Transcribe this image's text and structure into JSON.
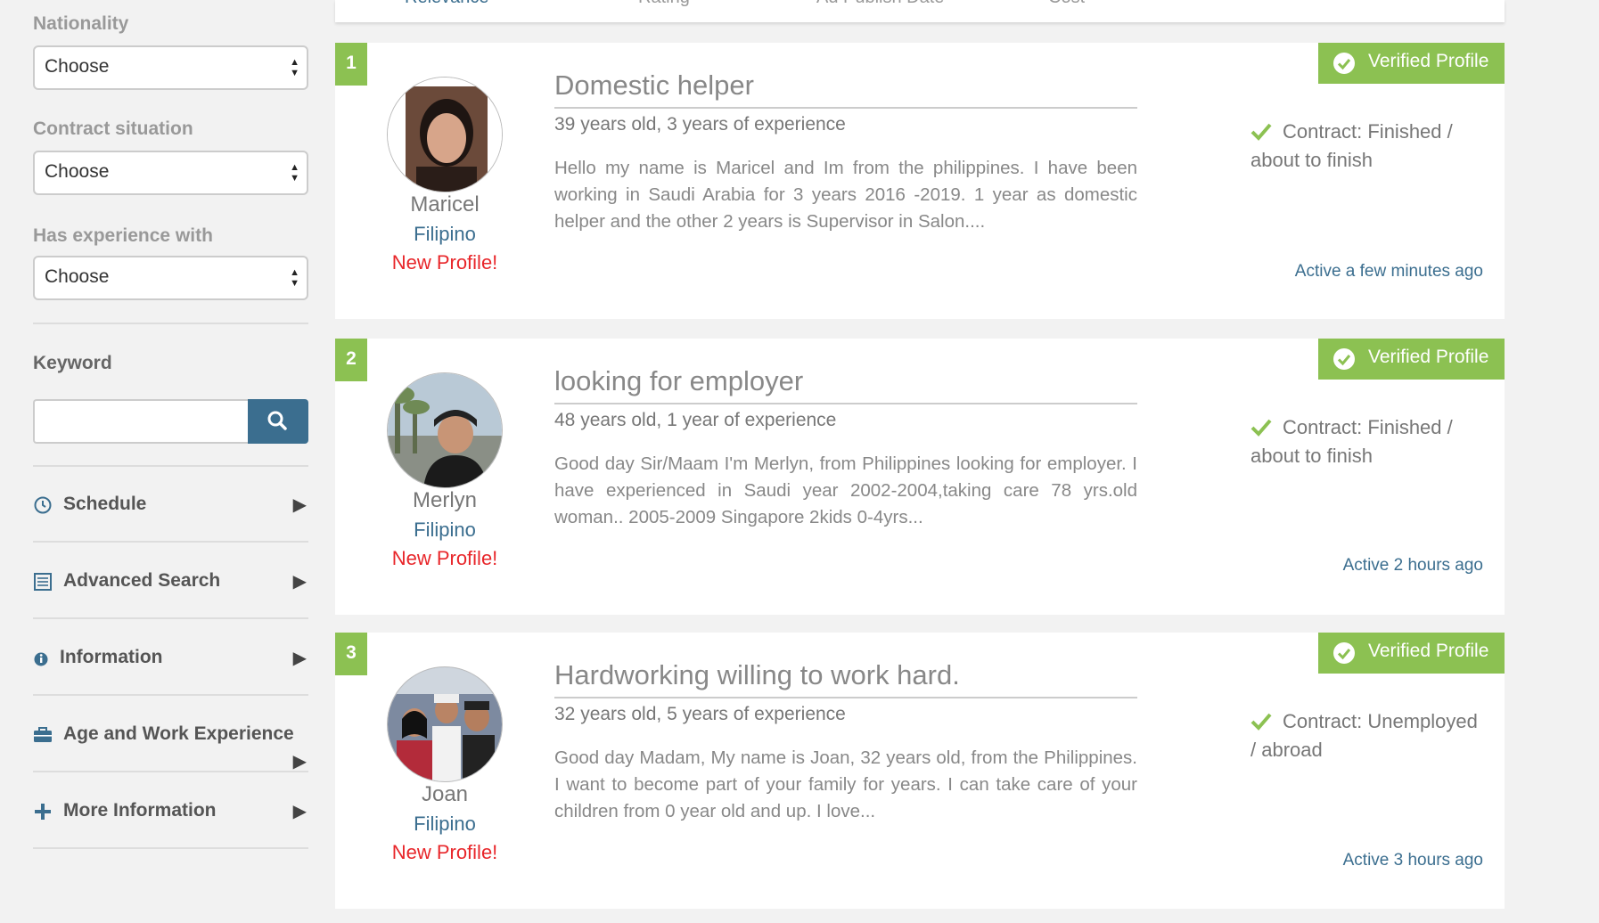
{
  "filters": {
    "nationality": {
      "label": "Nationality",
      "value": "Choose"
    },
    "contract_situation": {
      "label": "Contract situation",
      "value": "Choose"
    },
    "has_experience_with": {
      "label": "Has experience with",
      "value": "Choose"
    },
    "keyword": {
      "label": "Keyword",
      "value": "",
      "placeholder": ""
    }
  },
  "sections": [
    {
      "label": "Schedule",
      "icon": "clock-icon"
    },
    {
      "label": "Advanced Search",
      "icon": "list-icon"
    },
    {
      "label": "Information",
      "icon": "info-icon"
    },
    {
      "label": "Age and Work Experience",
      "icon": "briefcase-icon"
    },
    {
      "label": "More Information",
      "icon": "plus-icon"
    }
  ],
  "sort_options": [
    "Relevance",
    "Rating",
    "Ad Publish Date",
    "Cost"
  ],
  "verified_label": "Verified Profile",
  "results": [
    {
      "num": "1",
      "name": "Maricel",
      "nationality": "Filipino",
      "badge": "New Profile!",
      "title": "Domestic helper",
      "meta": "39 years old, 3 years of experience",
      "desc": "Hello my name is Maricel and Im from the philippines. I have been working in Saudi Arabia for 3 years 2016 -2019. 1 year as domestic helper and the other 2 years is Supervisor in Salon....",
      "contract": "Contract: Finished / about to finish",
      "active": "Active a few minutes ago"
    },
    {
      "num": "2",
      "name": "Merlyn",
      "nationality": "Filipino",
      "badge": "New Profile!",
      "title": "looking for employer",
      "meta": "48 years old, 1 year of experience",
      "desc": "Good day Sir/Maam I'm Merlyn, from Philippines looking for employer. I have experienced in Saudi year 2002-2004,taking care 78 yrs.old woman.. 2005-2009 Singapore 2kids 0-4yrs...",
      "contract": "Contract: Finished / about to finish",
      "active": "Active 2 hours ago"
    },
    {
      "num": "3",
      "name": "Joan",
      "nationality": "Filipino",
      "badge": "New Profile!",
      "title": "Hardworking willing to work hard.",
      "meta": "32 years old, 5 years of experience",
      "desc": "Good day Madam, My name is Joan, 32 years old, from the Philippines. I want to become part of your family for years. I can take care of your children from 0 year old and up. I love...",
      "contract": "Contract: Unemployed / abroad",
      "active": "Active 3 hours ago"
    }
  ],
  "colors": {
    "accent_green": "#8cc152",
    "link_blue": "#3b6e8f",
    "new_red": "#e8262a"
  }
}
